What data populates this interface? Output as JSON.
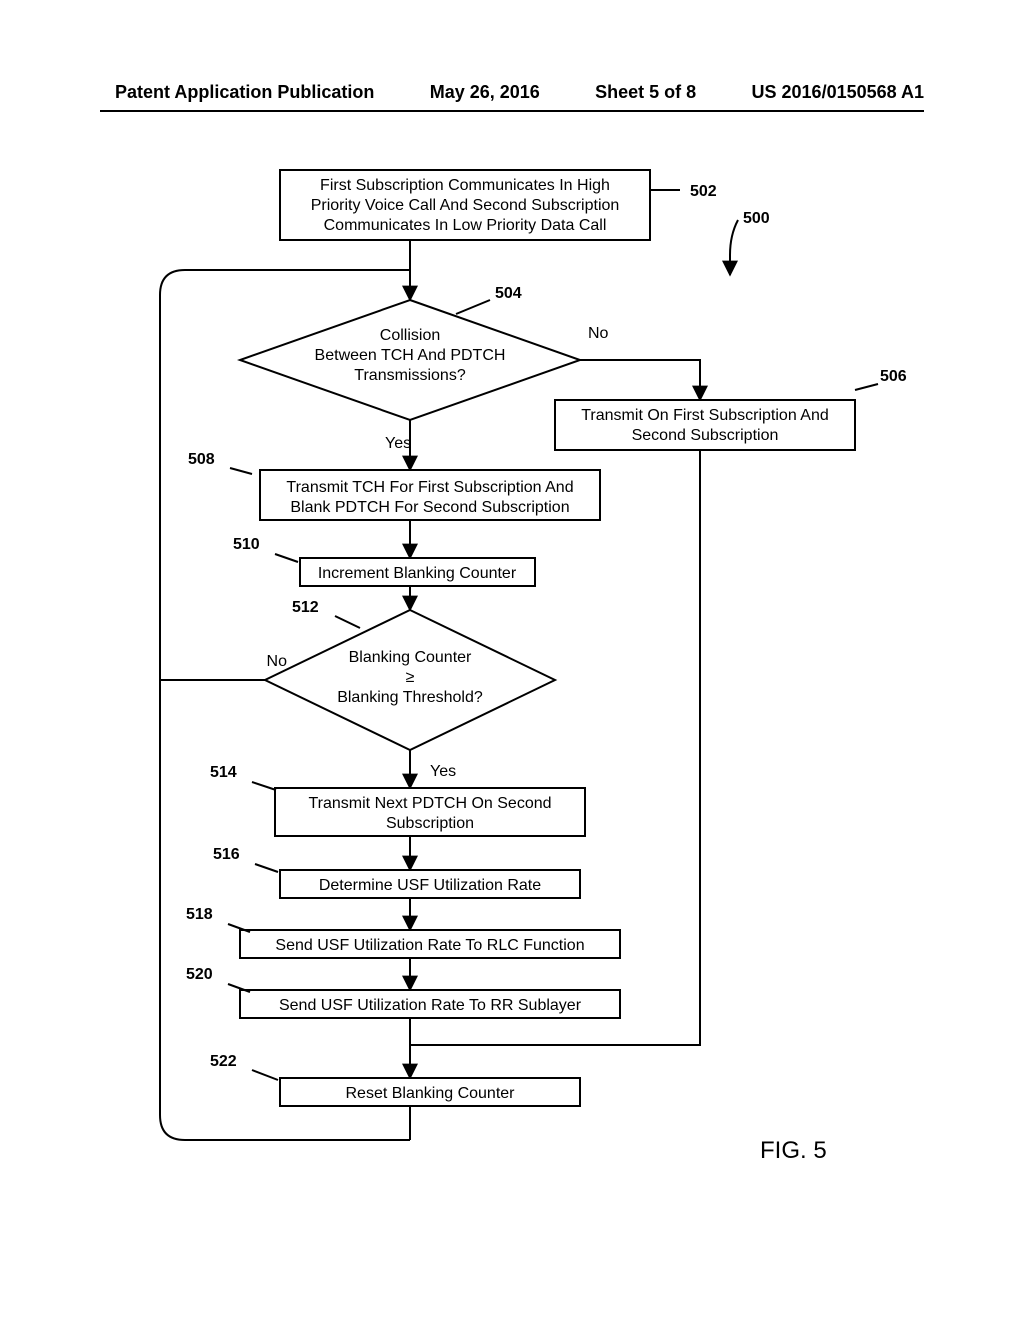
{
  "header": {
    "pub": "Patent Application Publication",
    "date": "May 26, 2016",
    "sheet": "Sheet 5 of 8",
    "docnum": "US 2016/0150568 A1"
  },
  "figure": {
    "name": "FIG. 5",
    "ref_main": "500",
    "nodes": {
      "n502": {
        "ref": "502",
        "line1": "First Subscription Communicates In High",
        "line2": "Priority Voice Call And Second Subscription",
        "line3": "Communicates In Low Priority Data Call"
      },
      "n504": {
        "ref": "504",
        "line1": "Collision",
        "line2": "Between TCH And PDTCH",
        "line3": "Transmissions?",
        "yes": "Yes",
        "no": "No"
      },
      "n506": {
        "ref": "506",
        "line1": "Transmit On First Subscription And",
        "line2": "Second Subscription"
      },
      "n508": {
        "ref": "508",
        "line1": "Transmit TCH For First Subscription And",
        "line2": "Blank PDTCH For Second Subscription"
      },
      "n510": {
        "ref": "510",
        "line1": "Increment Blanking Counter"
      },
      "n512": {
        "ref": "512",
        "line1": "Blanking Counter",
        "line2": "≥",
        "line3": "Blanking Threshold?",
        "yes": "Yes",
        "no": "No"
      },
      "n514": {
        "ref": "514",
        "line1": "Transmit Next PDTCH On Second",
        "line2": "Subscription"
      },
      "n516": {
        "ref": "516",
        "line1": "Determine USF Utilization Rate"
      },
      "n518": {
        "ref": "518",
        "line1": "Send USF Utilization Rate To RLC Function"
      },
      "n520": {
        "ref": "520",
        "line1": "Send USF Utilization Rate To RR Sublayer"
      },
      "n522": {
        "ref": "522",
        "line1": "Reset Blanking Counter"
      }
    }
  }
}
